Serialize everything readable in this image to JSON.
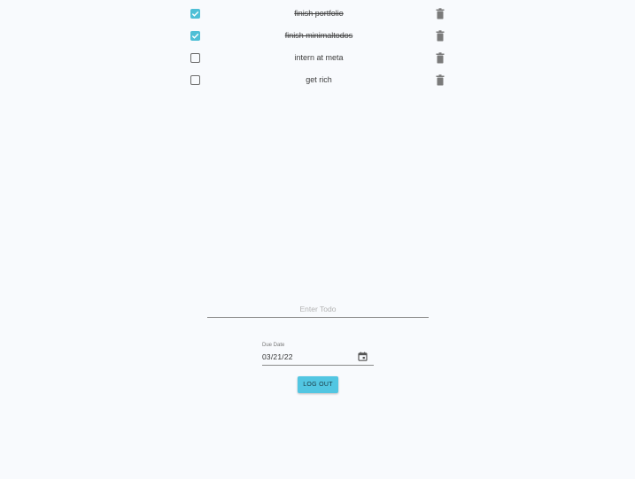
{
  "todos": [
    {
      "text": "finish portfolio",
      "completed": true
    },
    {
      "text": "finish minimaltodos",
      "completed": true
    },
    {
      "text": "intern at meta",
      "completed": false
    },
    {
      "text": "get rich",
      "completed": false
    }
  ],
  "new_todo": {
    "placeholder": "Enter Todo",
    "value": ""
  },
  "due_date": {
    "label": "Due Date",
    "value": "03/21/22"
  },
  "logout": {
    "label": "LOG OUT"
  },
  "colors": {
    "accent": "#52c6e2",
    "checkbox_checked": "#4fbfd6",
    "background": "#f8fafd"
  },
  "icons": {
    "delete": "trash-icon",
    "calendar": "calendar-icon",
    "check": "checkmark-icon"
  }
}
